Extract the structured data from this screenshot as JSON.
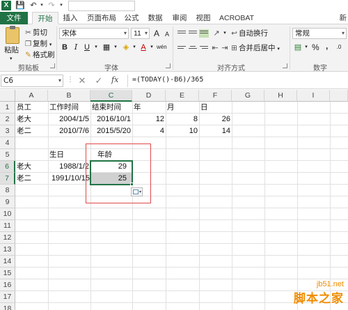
{
  "titlebar": {
    "app_icon_label": "X"
  },
  "tabs": [
    "文件",
    "开始",
    "插入",
    "页面布局",
    "公式",
    "数据",
    "审阅",
    "视图",
    "ACROBAT"
  ],
  "tab_overflow": "新",
  "ribbon": {
    "clipboard": {
      "paste": "粘贴",
      "cut": "剪切",
      "copy": "复制",
      "format_painter": "格式刷",
      "group": "剪贴板"
    },
    "font": {
      "name": "宋体",
      "size": "11",
      "bold": "B",
      "italic": "I",
      "underline": "U",
      "font_color_glyph": "A",
      "grow": "A",
      "shrink": "A",
      "phonetic": "wén",
      "group": "字体"
    },
    "alignment": {
      "wrap": "自动换行",
      "merge": "合并后居中",
      "group": "对齐方式"
    },
    "number": {
      "format": "常规",
      "percent": "%",
      "comma": ",",
      "group": "数字"
    }
  },
  "formula_bar": {
    "name_box": "C6",
    "fx": "fx",
    "formula": "=(TODAY()-B6)/365"
  },
  "columns": [
    "A",
    "B",
    "C",
    "D",
    "E",
    "F",
    "G",
    "H",
    "I"
  ],
  "rows": [
    "1",
    "2",
    "3",
    "4",
    "5",
    "6",
    "7",
    "8",
    "9",
    "10",
    "11",
    "12",
    "13",
    "14",
    "15",
    "16",
    "17",
    "18"
  ],
  "cells": {
    "A1": "员工",
    "B1": "工作时间",
    "C1": "结束时间",
    "D1": "年",
    "E1": "月",
    "F1": "日",
    "A2": "老大",
    "B2": "2004/1/5",
    "C2": "2016/10/1",
    "D2": "12",
    "E2": "8",
    "F2": "26",
    "A3": "老二",
    "B3": "2010/7/6",
    "C3": "2015/5/20",
    "D3": "4",
    "E3": "10",
    "F3": "14",
    "B5": "生日",
    "C5": "年龄",
    "A6": "老大",
    "B6": "1988/1/2",
    "C6": "29",
    "A7": "老二",
    "B7": "1991/10/15",
    "C7": "25"
  },
  "colors": {
    "excel_green": "#217346",
    "highlight_red": "#e04848",
    "watermark_orange": "#f08c00"
  },
  "watermark": {
    "site": "jb51.net",
    "brand": "脚本之家"
  }
}
